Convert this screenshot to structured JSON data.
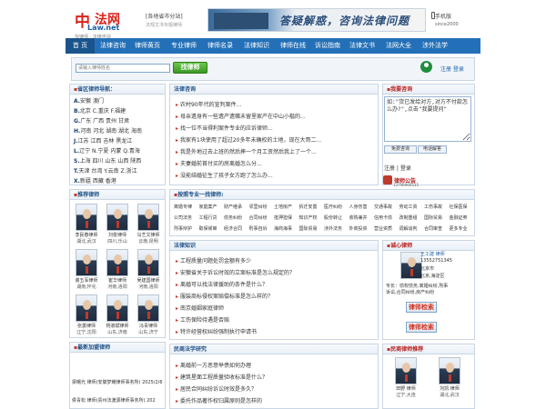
{
  "header": {
    "logo_cn": "中",
    "logo_cn2": "法网",
    "logo_domain": "Law.net",
    "logo_tagline": "找律师 · 法律咨询",
    "region_label": "[各地省市分站]",
    "region_sub": "法规文书专题律师",
    "banner_text": "答疑解惑，咨询法律问题",
    "mobile_label": "手机版",
    "since": "since2000"
  },
  "nav": {
    "items": [
      "首 页",
      "法律咨询",
      "律师黄页",
      "专业律师",
      "律师名录",
      "法律知识",
      "律师在线",
      "诉讼指南",
      "法律文书",
      "法网大全",
      "涉外法学"
    ]
  },
  "search": {
    "placeholder": "请输入律师姓名",
    "button": "找律师",
    "user_label": "注册 登录"
  },
  "region_nav": {
    "title": "省区律师导航：",
    "lines": [
      [
        "A.",
        "安徽 澳门"
      ],
      [
        "B.",
        "北京 C.重庆 F.福建"
      ],
      [
        "G.",
        "广东 广西 贵州 甘肃"
      ],
      [
        "H.",
        "河南 河北 湖南 湖北 海南"
      ],
      [
        "J.",
        "江苏 江西 吉林 黑龙江"
      ],
      [
        "L.",
        "辽宁 N.宁夏 内蒙 Q.青海"
      ],
      [
        "S.",
        "上海 四川 山东 山西 陕西"
      ],
      [
        "T.",
        "天津 台湾 Y.云南 Z.浙江"
      ],
      [
        "X.",
        "新疆 西藏 香港"
      ]
    ]
  },
  "recommend": {
    "title": "推荐律师",
    "lawyers": [
      {
        "name": "李民春律师",
        "city": "湖北,武汉"
      },
      {
        "name": "刘俊律师",
        "city": "四川,乐山"
      },
      {
        "name": "马艺文律师",
        "city": "云南,昆明"
      },
      {
        "name": "谢五军律师",
        "city": "湖南,怀化"
      },
      {
        "name": "崔华律师",
        "city": "河南,洛阳"
      },
      {
        "name": "吴建国律师",
        "city": "河南,洛阳"
      },
      {
        "name": "张勇律师",
        "city": "辽宁,沈阳"
      },
      {
        "name": "杨淑斌律师",
        "city": "山东,济南"
      },
      {
        "name": "冯青律师",
        "city": "山东,济宁"
      }
    ]
  },
  "newest": {
    "title": "最新加盟律师",
    "items": [
      "梁曙光 律师(安徽梦耀律师事务所) 2025/2/6",
      "侯青松 律师(贵州法渡源律师事务所) 202"
    ]
  },
  "consult": {
    "title": "法律咨询",
    "items": [
      "农村90年代的宣判案件...",
      "母亲遗身有一些遗产遗嘱未留里家产在中山小楷的...",
      "找一位不当得利案件专业的应诉律师...",
      "我家有1块使用了超过20多年未确权的土地，现在大哥二...",
      "我是外地过去上班的然后摔一个月工资然后我上了一个...",
      "夫妻婚前首付买的房离婚怎么分...",
      "没能结婚征生了孩子女方跑了怎么办..."
    ]
  },
  "question": {
    "title": "我要咨询",
    "text": "如:\"货已发给对方,对方不付款怎么办?\",点击\"我要提问\"",
    "free_consult": "免费咨询",
    "phone_consult": "电话解答",
    "auth": "注册 | 登录",
    "service_label": "律师公告",
    "service_phone": "13798966535"
  },
  "categories": {
    "title": "按照专业一找律师:",
    "items": [
      "离婚专律",
      "家庭案产",
      "财产继承",
      "邻里纠纷",
      "土地房产",
      "拆迁安置",
      "医疗纠纷",
      "人身伤害",
      "交通事故",
      "劳动工资",
      "工伤事故",
      "社保医保",
      "公司法务",
      "工程行贷",
      "债务纠纷",
      "合同纠纷",
      "抵押担保",
      "知识产权",
      "股份转让",
      "收购兼并",
      "信用卡债",
      "改制重组",
      "国际贸易",
      "金融证券",
      "刑事辩护",
      "取保候审",
      "经济合同",
      "刑事自诉",
      "海商海事",
      "国际贸易",
      "涉外法务",
      "外商投资",
      "营业资质",
      "调解谈判",
      "合同审查",
      "更多专业"
    ]
  },
  "knowledge": {
    "title": "法律知识",
    "items": [
      "工程质量问题处罚金额有多少",
      "安徽省关于诉讼时效的立案标准是怎么规定的？",
      "离婚可以找法律援助的条件是什么？",
      "服装商标侵权案赔偿标准是怎么样的？",
      "南京婚姻家庭律师",
      "工伤保险待遇是否赔",
      "特许经营权纠纷强制执行申请书"
    ]
  },
  "featured": {
    "title": "诚心律师",
    "name": "王工建 律师",
    "phone": "13552751345",
    "firm": "北京市",
    "area": "北京,海淀区",
    "desc1": "专长：债权债务,离婚纠纷,刑事",
    "desc2": "诉讼,合同纠纷,房产纠纷",
    "btn1": "律师检索",
    "btn2": "律师检索"
  },
  "civil": {
    "title": "民商法学研究",
    "items": [
      "离婚前一方恶意举债如何办理",
      "建筑星面工程质量验收标准是什么？",
      "居民合同纠纷诉讼时效是多久？",
      "委托作品著作权归属原则是怎样的"
    ]
  },
  "civil_lawyers": {
    "title": "民商律师推荐",
    "lawyers": [
      {
        "name": "田野 律师",
        "city": "辽宁,大连"
      },
      {
        "name": "刘凯 律师",
        "city": "湖北,武汉"
      }
    ]
  },
  "colors": {
    "nav_bg": "#2470b8",
    "brand_red": "#d9231b",
    "panel_title": "#1c4f87"
  }
}
